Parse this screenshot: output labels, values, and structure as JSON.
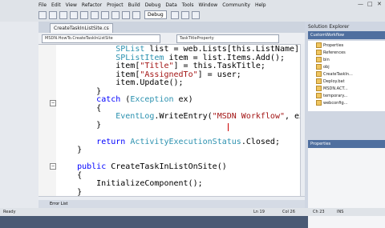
{
  "menu": [
    "File",
    "Edit",
    "View",
    "Refactor",
    "Project",
    "Build",
    "Debug",
    "Data",
    "Tools",
    "Window",
    "Community",
    "Help"
  ],
  "toolbar": {
    "config": "Debug"
  },
  "document_tab": "CreateTaskInListSite.cs",
  "nav": {
    "left": "MSDN.HowTo.CreateTaskInListSite",
    "right": "TaskTitleProperty"
  },
  "code_lines": [
    [
      {
        "t": "            "
      },
      {
        "t": "SPList",
        "c": "ty"
      },
      {
        "t": " list = web.Lists[this.ListName];"
      }
    ],
    [
      {
        "t": "            "
      },
      {
        "t": "SPListItem",
        "c": "ty"
      },
      {
        "t": " item = list.Items.Add();"
      }
    ],
    [
      {
        "t": "            item["
      },
      {
        "t": "\"Title\"",
        "c": "st"
      },
      {
        "t": "] = this.TaskTitle;"
      }
    ],
    [
      {
        "t": "            item["
      },
      {
        "t": "\"AssignedTo\"",
        "c": "st"
      },
      {
        "t": "] = user;"
      }
    ],
    [
      {
        "t": "            item.Update();"
      }
    ],
    [
      {
        "t": "        }"
      }
    ],
    [
      {
        "t": "        "
      },
      {
        "t": "catch",
        "c": "kw"
      },
      {
        "t": " ("
      },
      {
        "t": "Exception",
        "c": "ty"
      },
      {
        "t": " ex)"
      }
    ],
    [
      {
        "t": "        {"
      }
    ],
    [
      {
        "t": "            "
      },
      {
        "t": "EventLog",
        "c": "ty"
      },
      {
        "t": ".WriteEntry("
      },
      {
        "t": "\"MSDN Workflow\"",
        "c": "st"
      },
      {
        "t": ", ex.To"
      }
    ],
    [
      {
        "t": "        }"
      }
    ],
    [
      {
        "t": ""
      }
    ],
    [
      {
        "t": "        "
      },
      {
        "t": "return",
        "c": "kw"
      },
      {
        "t": " "
      },
      {
        "t": "ActivityExecutionStatus",
        "c": "ty"
      },
      {
        "t": ".Closed;"
      }
    ],
    [
      {
        "t": "    }"
      }
    ],
    [
      {
        "t": ""
      }
    ],
    [
      {
        "t": "    "
      },
      {
        "t": "public",
        "c": "kw"
      },
      {
        "t": " CreateTaskInListOnSite()"
      }
    ],
    [
      {
        "t": "    {"
      }
    ],
    [
      {
        "t": "        InitializeComponent();"
      }
    ],
    [
      {
        "t": "    }"
      }
    ]
  ],
  "right_panel": {
    "title": "Solution Explorer",
    "header": "CustomWorkflow",
    "tree": [
      "Properties",
      "References",
      "bin",
      "obj",
      "CreateTaskIn...",
      "Deploy.bat",
      "MSDN.ACT...",
      "temporary...",
      "webconfig..."
    ],
    "props_header": "Properties"
  },
  "bottom_tab": "Error List",
  "status": {
    "left": "Ready",
    "ln": "Ln 19",
    "col": "Col 26",
    "ch": "Ch 23",
    "ins": "INS"
  }
}
